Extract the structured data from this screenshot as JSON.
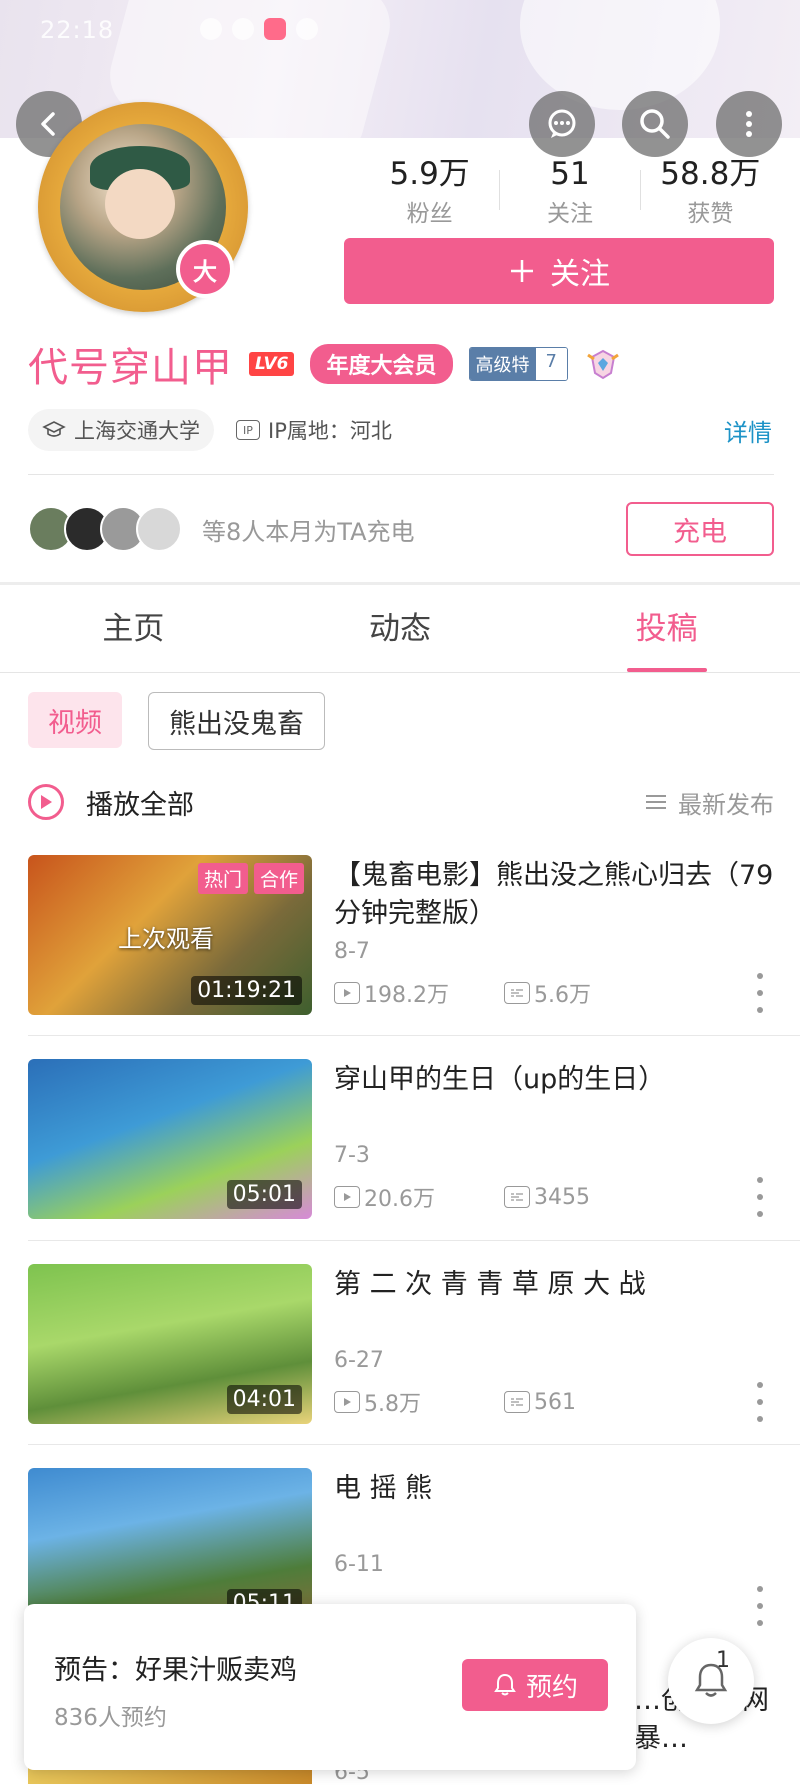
{
  "status_bar": {
    "time": "22:18"
  },
  "header": {
    "back_icon": "back-arrow-icon",
    "message_icon": "message-icon",
    "search_icon": "search-icon",
    "more_icon": "more-vertical-icon"
  },
  "profile": {
    "big_member_badge": "大",
    "name": "代号穿山甲",
    "level": "LV6",
    "vip_label": "年度大会员",
    "gaoji_label": "高级特",
    "gaoji_num": "7",
    "school": "上海交通大学",
    "ip_label": "IP属地：河北",
    "detail_link": "详情"
  },
  "stats": [
    {
      "num": "5.9万",
      "label": "粉丝"
    },
    {
      "num": "51",
      "label": "关注"
    },
    {
      "num": "58.8万",
      "label": "获赞"
    }
  ],
  "follow_button": "关注",
  "charge": {
    "text": "等8人本月为TA充电",
    "button": "充电"
  },
  "tabs": [
    "主页",
    "动态",
    "投稿"
  ],
  "active_tab": "投稿",
  "chips": [
    "视频",
    "熊出没鬼畜"
  ],
  "play_all": "播放全部",
  "sort_label": "最新发布",
  "videos": [
    {
      "title": "【鬼畜电影】熊出没之熊心归去（79分钟完整版）",
      "date": "8-7",
      "views": "198.2万",
      "danmaku": "5.6万",
      "duration": "01:19:21",
      "badges": [
        "热门",
        "合作"
      ],
      "overlay": "上次观看"
    },
    {
      "title": "穿山甲的生日（up的生日）",
      "date": "7-3",
      "views": "20.6万",
      "danmaku": "3455",
      "duration": "05:01"
    },
    {
      "title": "第 二 次 青 青 草 原 大 战",
      "date": "6-27",
      "views": "5.8万",
      "danmaku": "561",
      "duration": "04:01"
    },
    {
      "title": "电 摇 熊",
      "date": "6-11",
      "duration": "05:11"
    }
  ],
  "notice": {
    "title": "预告：好果汁贩卖鸡",
    "sub": "836人预约",
    "button": "预约"
  },
  "bell_count": "1",
  "peek": {
    "title": "…创…丝网暴…",
    "date": "6-5"
  },
  "colors": {
    "accent": "#f25d8e",
    "link": "#1d93c7"
  }
}
